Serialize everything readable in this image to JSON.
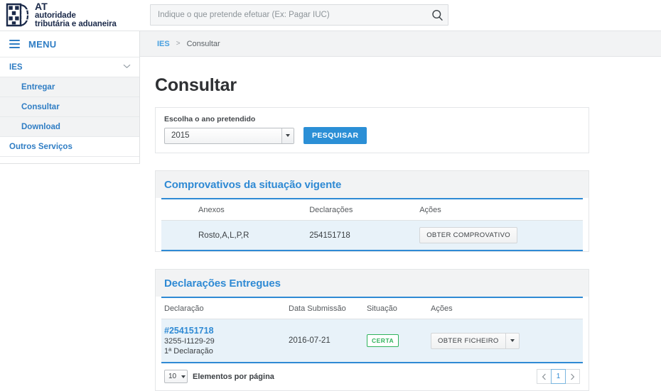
{
  "header": {
    "brand": {
      "line1": "AT",
      "line2": "autoridade",
      "line3": "tributária e aduaneira",
      "logo_icon": "portugal-coat-of-arms-icon",
      "logo_color": "#1b2a4a"
    },
    "search": {
      "placeholder": "Indique o que pretende efetuar (Ex: Pagar IUC)",
      "value": "",
      "icon": "search-icon"
    }
  },
  "sidebar": {
    "menu_label": "MENU",
    "menu_icon": "hamburger-icon",
    "items": [
      {
        "label": "IES",
        "level": "top",
        "expanded": true,
        "icon": "chevron-down-icon"
      },
      {
        "label": "Entregar",
        "level": "sub"
      },
      {
        "label": "Consultar",
        "level": "sub"
      },
      {
        "label": "Download",
        "level": "sub"
      },
      {
        "label": "Outros Serviços",
        "level": "top"
      }
    ]
  },
  "breadcrumb": {
    "root": "IES",
    "separator": ">",
    "current": "Consultar"
  },
  "page": {
    "title": "Consultar"
  },
  "filter": {
    "label": "Escolha o ano pretendido",
    "year_value": "2015",
    "search_button": "PESQUISAR"
  },
  "section_comprovativos": {
    "title": "Comprovativos da situação vigente",
    "columns": [
      "Anexos",
      "Declarações",
      "Ações"
    ],
    "rows": [
      {
        "anexos": "Rosto,A,L,P,R",
        "declaracoes": "254151718",
        "action_label": "OBTER COMPROVATIVO"
      }
    ]
  },
  "section_declaracoes": {
    "title": "Declarações Entregues",
    "columns": [
      "Declaração",
      "Data Submissão",
      "Situação",
      "Ações"
    ],
    "rows": [
      {
        "declaracao_id": "#254151718",
        "declaracao_ref": "3255-I1129-29",
        "declaracao_ordem": "1ª Declaração",
        "data_submissao": "2016-07-21",
        "situacao": "CERTA",
        "situacao_color": "#2fb35c",
        "action_label": "OBTER FICHEIRO",
        "action_caret_icon": "caret-down-icon"
      }
    ],
    "footer": {
      "per_page_value": "10",
      "per_page_label": "Elementos por página",
      "pager": {
        "prev_icon": "chevron-left-icon",
        "pages": [
          "1"
        ],
        "active_page": "1",
        "next_icon": "chevron-right-icon"
      }
    }
  },
  "colors": {
    "accent_blue": "#2f8ad4",
    "link_blue": "#2f7dc4",
    "row_highlight": "#e8f2f9",
    "panel_grey": "#f2f3f4"
  }
}
